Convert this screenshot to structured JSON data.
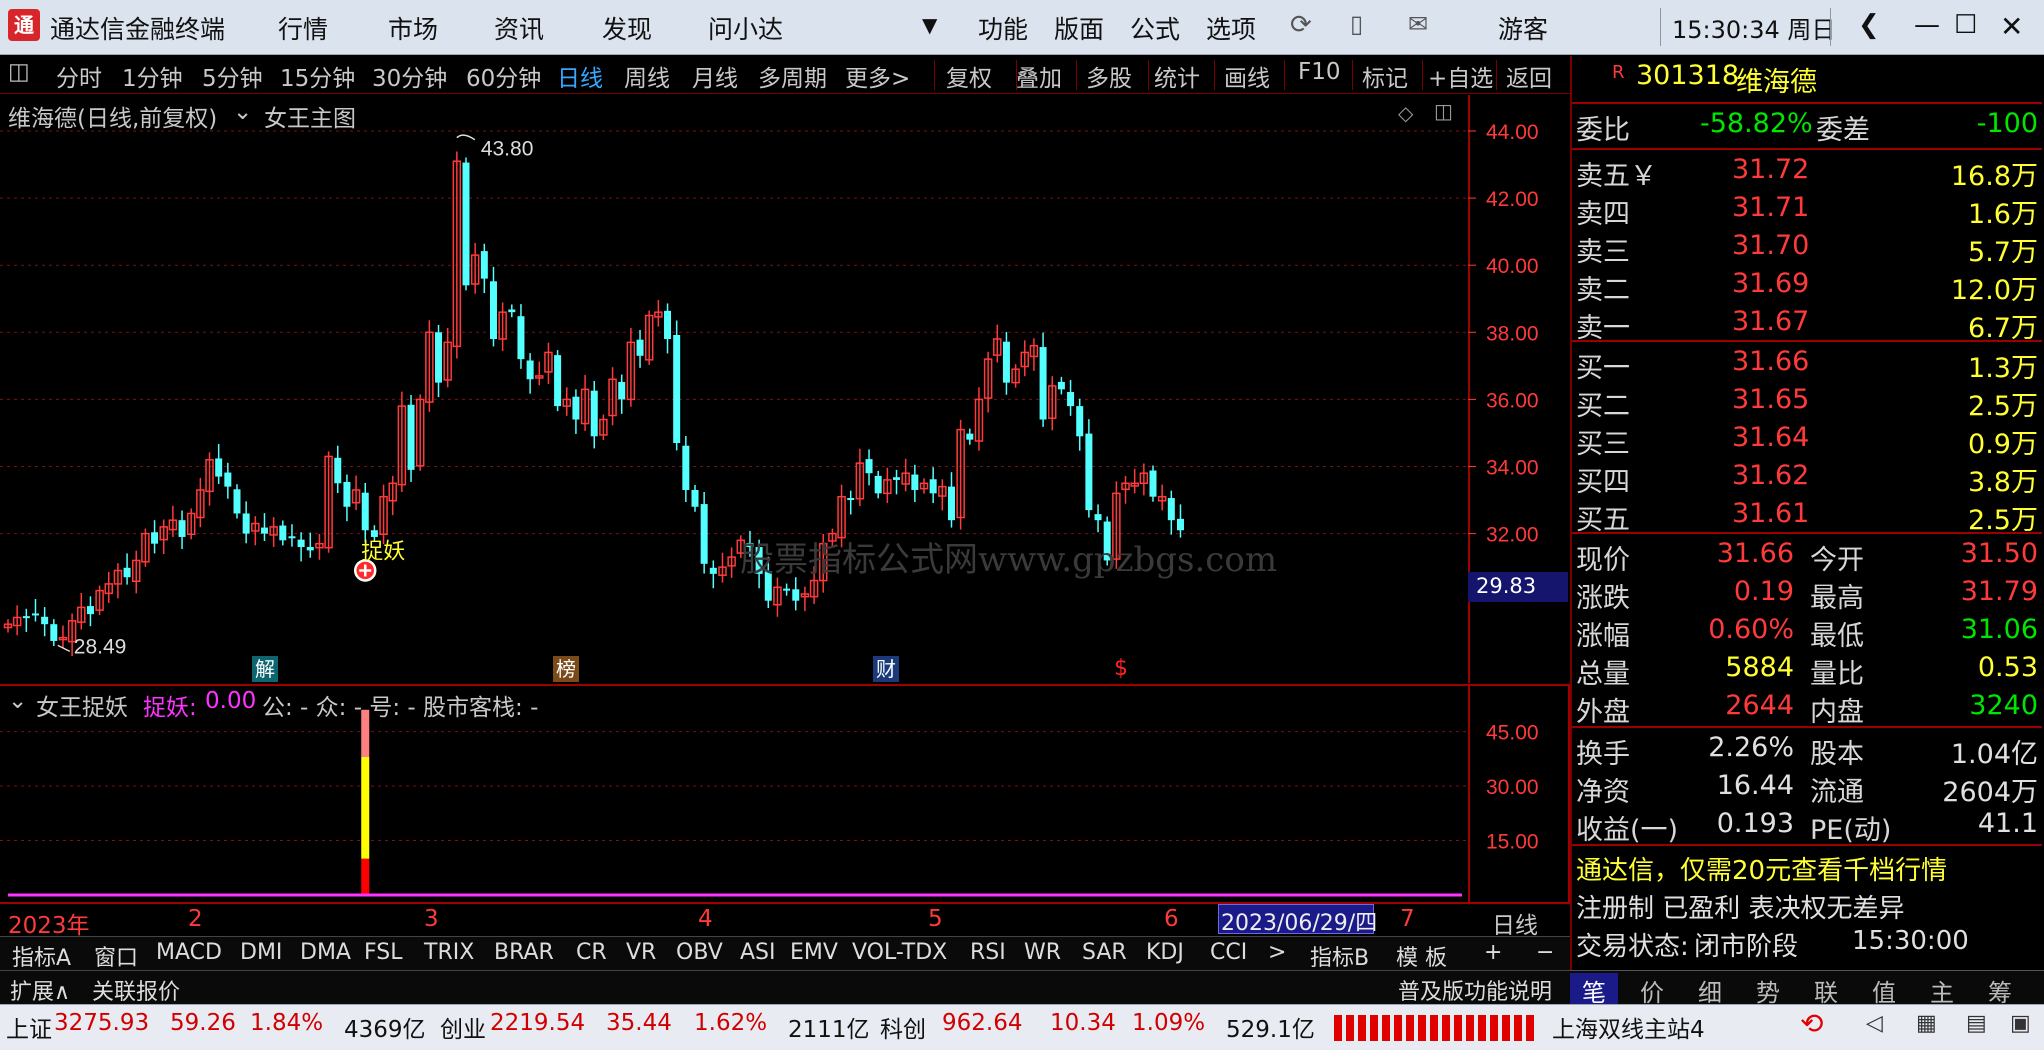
{
  "window": {
    "title": "通达信金融终端",
    "menus": [
      "行情",
      "市场",
      "资讯",
      "发现",
      "问小达",
      "功能",
      "版面",
      "公式",
      "选项"
    ],
    "user": "游客",
    "clock": "15:30:34 周日"
  },
  "periods": {
    "items": [
      "分时",
      "1分钟",
      "5分钟",
      "15分钟",
      "30分钟",
      "60分钟",
      "日线",
      "周线",
      "月线",
      "多周期",
      "更多>"
    ],
    "active": "日线",
    "tools": [
      "复权",
      "叠加",
      "多股",
      "统计",
      "画线",
      "F10",
      "标记",
      "+自选",
      "返回"
    ]
  },
  "main_chart": {
    "header": "维海德(日线,前复权)",
    "indicator_name": "女王主图",
    "high_label": "43.80",
    "low_label": "28.49",
    "signal": "捉妖",
    "current_price_tag": "29.83",
    "watermark": "股票指标公式网www.gpzbgs.com",
    "markers": [
      "解",
      "榜",
      "财",
      "$"
    ]
  },
  "sub_chart": {
    "title": "女王捉妖",
    "metric_label": "捉妖:",
    "metric_value": "0.00",
    "extra": "公: -  众: -  号: -  股市客栈: -"
  },
  "timeline": {
    "year": "2023年",
    "months": [
      "2",
      "3",
      "4",
      "5",
      "6",
      "7"
    ],
    "cursor_date": "2023/06/29/四",
    "period": "日线"
  },
  "indicator_tabs": {
    "a_label": "指标A",
    "items": [
      "窗口",
      "MACD",
      "DMI",
      "DMA",
      "FSL",
      "TRIX",
      "BRAR",
      "CR",
      "VR",
      "OBV",
      "ASI",
      "EMV",
      "VOL-TDX",
      "RSI",
      "WR",
      "SAR",
      "KDJ",
      "CCI",
      ">"
    ],
    "b_label": "指标B",
    "template": "模 板",
    "plus": "+",
    "minus": "−"
  },
  "ext_bar": {
    "expand": "扩展∧",
    "related": "关联报价",
    "promo": "普及版功能说明"
  },
  "quote_panel": {
    "badge": "R",
    "code": "301318",
    "name": "维海德",
    "weibi": {
      "label": "委比",
      "value": "-58.82%",
      "label2": "委差",
      "value2": "-100"
    },
    "asks": [
      {
        "label": "卖五￥",
        "price": "31.72",
        "vol": "16.8万"
      },
      {
        "label": "卖四",
        "price": "31.71",
        "vol": "1.6万"
      },
      {
        "label": "卖三",
        "price": "31.70",
        "vol": "5.7万"
      },
      {
        "label": "卖二",
        "price": "31.69",
        "vol": "12.0万"
      },
      {
        "label": "卖一",
        "price": "31.67",
        "vol": "6.7万"
      }
    ],
    "bids": [
      {
        "label": "买一",
        "price": "31.66",
        "vol": "1.3万"
      },
      {
        "label": "买二",
        "price": "31.65",
        "vol": "2.5万"
      },
      {
        "label": "买三",
        "price": "31.64",
        "vol": "0.9万"
      },
      {
        "label": "买四",
        "price": "31.62",
        "vol": "3.8万"
      },
      {
        "label": "买五",
        "price": "31.61",
        "vol": "2.5万"
      }
    ],
    "stats": [
      {
        "l1": "现价",
        "v1": "31.66",
        "l2": "今开",
        "v2": "31.50"
      },
      {
        "l1": "涨跌",
        "v1": "0.19",
        "l2": "最高",
        "v2": "31.79"
      },
      {
        "l1": "涨幅",
        "v1": "0.60%",
        "l2": "最低",
        "v2": "31.06"
      },
      {
        "l1": "总量",
        "v1": "5884",
        "l2": "量比",
        "v2": "0.53"
      },
      {
        "l1": "外盘",
        "v1": "2644",
        "l2": "内盘",
        "v2": "3240"
      }
    ],
    "fund": [
      {
        "l1": "换手",
        "v1": "2.26%",
        "l2": "股本",
        "v2": "1.04亿"
      },
      {
        "l1": "净资",
        "v1": "16.44",
        "l2": "流通",
        "v2": "2604万"
      },
      {
        "l1": "收益(一)",
        "v1": "0.193",
        "l2": "PE(动)",
        "v2": "41.1"
      }
    ],
    "ad": "通达信，仅需20元查看千档行情",
    "reg": "注册制 已盈利 表决权无差异",
    "trade_label": "交易状态:",
    "trade_state": "闭市阶段",
    "trade_time": "15:30:00",
    "tabs": [
      "笔",
      "价",
      "细",
      "势",
      "联",
      "值",
      "主",
      "筹"
    ]
  },
  "status_bar": {
    "sh": {
      "label": "上证",
      "index": "3275.93",
      "chg": "59.26",
      "pct": "1.84%",
      "amt": "4369亿"
    },
    "cy": {
      "label": "创业",
      "index": "2219.54",
      "chg": "35.44",
      "pct": "1.62%",
      "amt": "2111亿"
    },
    "kc": {
      "label": "科创",
      "index": "962.64",
      "chg": "10.34",
      "pct": "1.09%",
      "amt": "529.1亿"
    },
    "server": "上海双线主站4"
  },
  "chart_data": {
    "type": "candlestick",
    "title": "维海德(日线,前复权)",
    "dates": [
      "2023-01-03",
      "2023-01-04",
      "2023-01-05",
      "2023-01-06",
      "2023-01-09",
      "2023-01-10",
      "2023-01-11",
      "2023-01-12",
      "2023-01-13",
      "2023-01-16",
      "2023-01-17",
      "2023-01-18",
      "2023-01-19",
      "2023-01-20",
      "2023-01-30",
      "2023-01-31",
      "2023-02-01",
      "2023-02-02",
      "2023-02-03",
      "2023-02-06",
      "2023-02-07",
      "2023-02-08",
      "2023-02-09",
      "2023-02-10",
      "2023-02-13",
      "2023-02-14",
      "2023-02-15",
      "2023-02-16",
      "2023-02-17",
      "2023-02-20",
      "2023-02-21",
      "2023-02-22",
      "2023-02-23",
      "2023-02-24",
      "2023-02-27",
      "2023-02-28",
      "2023-03-01",
      "2023-03-02",
      "2023-03-03",
      "2023-03-06",
      "2023-03-07",
      "2023-03-08",
      "2023-03-09",
      "2023-03-10",
      "2023-03-13",
      "2023-03-14",
      "2023-03-15",
      "2023-03-16",
      "2023-03-17",
      "2023-03-20",
      "2023-03-21",
      "2023-03-22",
      "2023-03-23",
      "2023-03-24",
      "2023-03-27",
      "2023-03-28",
      "2023-03-29",
      "2023-03-30",
      "2023-03-31",
      "2023-04-03",
      "2023-04-04",
      "2023-04-06",
      "2023-04-07",
      "2023-04-10",
      "2023-04-11",
      "2023-04-12",
      "2023-04-13",
      "2023-04-14",
      "2023-04-17",
      "2023-04-18",
      "2023-04-19",
      "2023-04-20",
      "2023-04-21",
      "2023-04-24",
      "2023-04-25",
      "2023-04-26",
      "2023-04-27",
      "2023-04-28",
      "2023-05-04",
      "2023-05-05",
      "2023-05-08",
      "2023-05-09",
      "2023-05-10",
      "2023-05-11",
      "2023-05-12",
      "2023-05-15",
      "2023-05-16",
      "2023-05-17",
      "2023-05-18",
      "2023-05-19",
      "2023-05-22",
      "2023-05-23",
      "2023-05-24",
      "2023-05-25",
      "2023-05-26",
      "2023-05-29",
      "2023-05-30",
      "2023-05-31",
      "2023-06-01",
      "2023-06-02",
      "2023-06-05",
      "2023-06-06",
      "2023-06-07",
      "2023-06-08",
      "2023-06-09",
      "2023-06-12",
      "2023-06-13",
      "2023-06-14",
      "2023-06-15",
      "2023-06-16",
      "2023-06-19",
      "2023-06-20",
      "2023-06-21",
      "2023-06-26",
      "2023-06-27",
      "2023-06-28",
      "2023-06-29",
      "2023-06-30",
      "2023-07-03",
      "2023-07-04",
      "2023-07-05",
      "2023-07-06",
      "2023-07-07",
      "2023-07-10",
      "2023-07-11",
      "2023-07-12",
      "2023-07-13",
      "2023-07-14",
      "2023-07-17"
    ],
    "close": [
      29.3,
      29.5,
      29.5,
      29.6,
      29.3,
      28.8,
      28.9,
      29.4,
      29.8,
      29.6,
      30.3,
      30.5,
      30.9,
      30.7,
      31.2,
      32.0,
      31.7,
      32.2,
      32.4,
      31.9,
      32.6,
      33.3,
      34.2,
      33.7,
      33.4,
      32.6,
      32.0,
      32.3,
      32.0,
      32.2,
      31.8,
      31.9,
      31.6,
      31.5,
      31.7,
      34.3,
      33.5,
      32.8,
      33.3,
      32.1,
      31.9,
      33.1,
      33.5,
      35.8,
      33.9,
      36.0,
      38.0,
      36.5,
      37.7,
      43.1,
      39.4,
      40.3,
      39.6,
      37.8,
      38.6,
      38.6,
      37.2,
      36.6,
      36.7,
      37.4,
      35.8,
      36.0,
      35.4,
      36.3,
      34.9,
      35.4,
      36.6,
      36.0,
      37.7,
      37.3,
      38.5,
      38.6,
      37.8,
      34.7,
      33.3,
      32.8,
      31.1,
      30.8,
      31.0,
      31.3,
      31.8,
      31.6,
      30.8,
      30.0,
      30.4,
      30.3,
      30.0,
      30.2,
      30.6,
      31.7,
      32.0,
      33.1,
      33.0,
      34.1,
      33.8,
      33.2,
      33.6,
      33.6,
      33.8,
      33.3,
      33.5,
      33.2,
      33.4,
      32.4,
      35.1,
      34.8,
      36.0,
      37.2,
      37.8,
      36.5,
      36.9,
      37.4,
      37.6,
      35.4,
      36.4,
      36.3,
      35.8,
      34.9,
      32.7,
      32.4,
      31.2,
      33.2,
      33.5,
      33.5,
      33.8,
      33.1,
      33.1,
      32.4,
      32.1
    ],
    "indicator": {
      "name": "捉妖",
      "peak_value": 51,
      "peak_date": "2023-03-06",
      "yticks": [
        15,
        30,
        45
      ]
    },
    "ylim": [
      29.83,
      44.0
    ],
    "yticks": [
      32,
      34,
      36,
      38,
      40,
      42,
      44
    ],
    "high": 43.8,
    "low": 28.49,
    "signal_date": "2023-03-06",
    "xlabels": [
      "2023年",
      "2",
      "3",
      "4",
      "5",
      "6",
      "7"
    ]
  }
}
